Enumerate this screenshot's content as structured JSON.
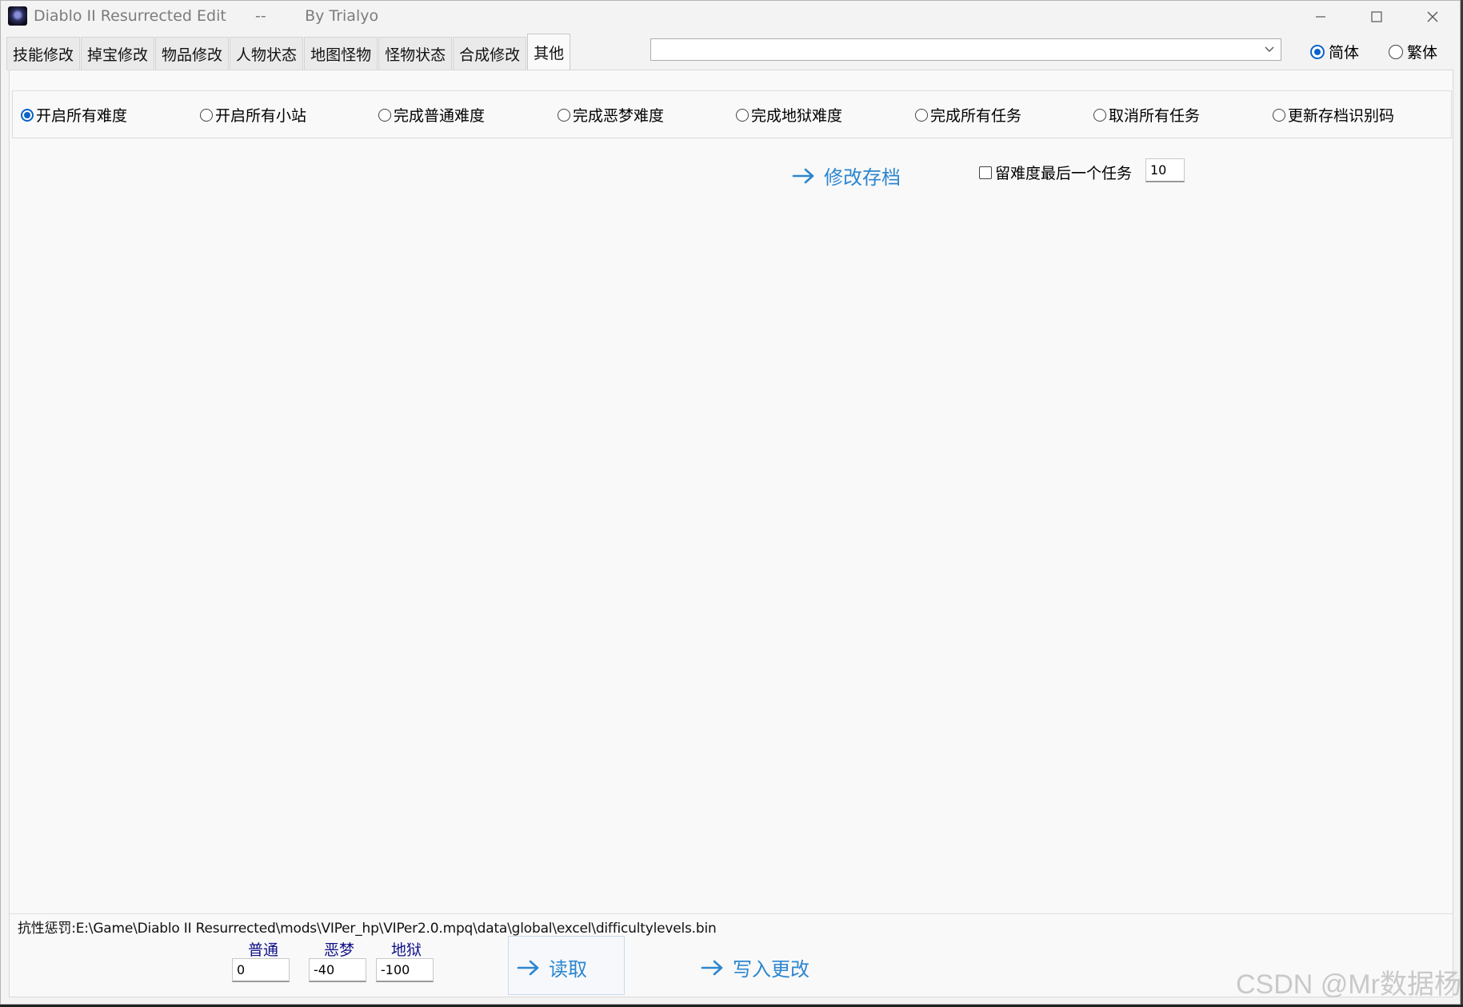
{
  "window": {
    "title": "Diablo II Resurrected Edit      --        By Trialyo",
    "controls": {
      "minimize_icon": "minimize-icon",
      "maximize_icon": "maximize-icon",
      "close_icon": "close-icon"
    }
  },
  "tabs": [
    {
      "label": "技能修改"
    },
    {
      "label": "掉宝修改"
    },
    {
      "label": "物品修改"
    },
    {
      "label": "人物状态"
    },
    {
      "label": "地图怪物"
    },
    {
      "label": "怪物状态"
    },
    {
      "label": "合成修改"
    },
    {
      "label": "其他",
      "active": true
    }
  ],
  "combo": {
    "value": ""
  },
  "language": {
    "simplified": {
      "label": "简体",
      "checked": true
    },
    "traditional": {
      "label": "繁体",
      "checked": false
    }
  },
  "options": [
    {
      "label": "开启所有难度",
      "checked": true
    },
    {
      "label": "开启所有小站",
      "checked": false
    },
    {
      "label": "完成普通难度",
      "checked": false
    },
    {
      "label": "完成恶梦难度",
      "checked": false
    },
    {
      "label": "完成地狱难度",
      "checked": false
    },
    {
      "label": "完成所有任务",
      "checked": false
    },
    {
      "label": "取消所有任务",
      "checked": false
    },
    {
      "label": "更新存档识别码",
      "checked": false
    }
  ],
  "modify_save": {
    "label": "修改存档"
  },
  "keep_last_quest": {
    "label": "留难度最后一个任务",
    "checked": false,
    "value": "10"
  },
  "resistance": {
    "path_label": "抗性惩罚:E:\\Game\\Diablo II Resurrected\\mods\\VIPer_hp\\VIPer2.0.mpq\\data\\global\\excel\\difficultylevels.bin",
    "normal": {
      "label": "普通",
      "value": "0"
    },
    "nightmare": {
      "label": "恶梦",
      "value": "-40"
    },
    "hell": {
      "label": "地狱",
      "value": "-100"
    },
    "read_label": "读取",
    "write_label": "写入更改"
  },
  "watermark": "CSDN @Mr数据杨",
  "colors": {
    "accent": "#2c86d0",
    "radio_checked": "#0b63c9",
    "label_blue": "#10108a"
  }
}
